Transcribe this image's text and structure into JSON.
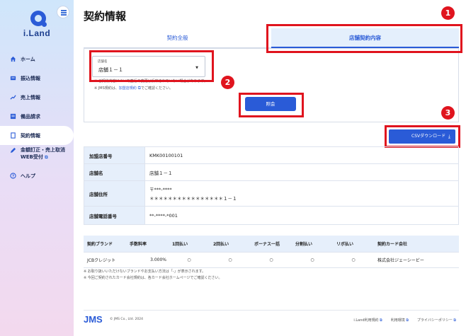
{
  "app": {
    "logo": "i.Land"
  },
  "sidebar": {
    "items": [
      {
        "label": "ホーム",
        "icon": "home-icon"
      },
      {
        "label": "振込情報",
        "icon": "bank-icon"
      },
      {
        "label": "売上情報",
        "icon": "chart-icon"
      },
      {
        "label": "備品請求",
        "icon": "invoice-icon"
      },
      {
        "label": "契約情報",
        "icon": "document-icon",
        "active": true
      },
      {
        "label": "金額訂正・売上取消",
        "label2": "WEB受付",
        "icon": "edit-icon",
        "external": true
      },
      {
        "label": "ヘルプ",
        "icon": "help-icon"
      }
    ]
  },
  "page": {
    "title": "契約情報"
  },
  "tabs": {
    "left": "契約全般",
    "right": "店舗契約内容"
  },
  "search": {
    "select_label": "店舗名",
    "select_value": "店舗１－１",
    "note1": "※ ご契約内容について直近の変更は反映されていない場合があります。",
    "note2_prefix": "※ JMS規約は、",
    "note2_link": "加盟店規約",
    "note2_suffix": "でご確認ください。",
    "button": "照会"
  },
  "csv_button": "CSVダウンロード",
  "badges": [
    "1",
    "2",
    "3"
  ],
  "info": {
    "rows": [
      {
        "key": "加盟店番号",
        "value": "KMK00100101"
      },
      {
        "key": "店舗名",
        "value": "店舗１－１"
      },
      {
        "key": "店舗住所",
        "value": "〒***-****",
        "value2": "＊＊＊＊＊＊＊＊＊＊＊＊＊＊＊＊１－１"
      },
      {
        "key": "店舗電話番号",
        "value": "**-****-*001"
      }
    ]
  },
  "brand": {
    "headers": [
      "契約ブランド",
      "手数料率",
      "1回払い",
      "2回払い",
      "ボーナス一括",
      "分割払い",
      "リボ払い",
      "契約カード会社"
    ],
    "rows": [
      [
        "JCBクレジット",
        "3.000%",
        "○",
        "○",
        "○",
        "○",
        "○",
        "株式会社ジェーシービー"
      ]
    ]
  },
  "footnotes": [
    "※ お取り扱いいただけないブランドやお支払い方法は「-」が表示されます。",
    "※ 今回ご契約されたカード会社規約は、各カード会社ホームページでご確認ください。"
  ],
  "footer": {
    "brand": "JMS",
    "copyright": "© JMS Co., Ltd. 2024",
    "links": [
      "i.Land利用規約",
      "利用環境",
      "プライバシーポリシー"
    ]
  },
  "colors": {
    "accent": "#2a5bd7",
    "highlight": "#e0141e"
  }
}
